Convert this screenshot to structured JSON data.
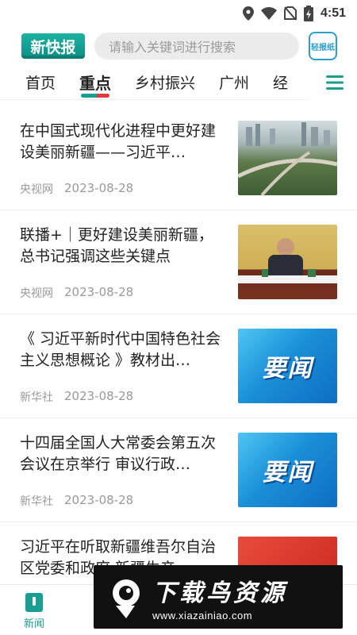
{
  "status_bar": {
    "time": "4:51",
    "icons": [
      "location-icon",
      "wifi-icon",
      "no-sim-icon",
      "battery-charging-icon"
    ]
  },
  "header": {
    "logo_text": "新快报",
    "search_placeholder": "请输入关键词进行搜索",
    "paper_button_label": "轻报纸"
  },
  "tabs": [
    {
      "label": "首页",
      "active": false
    },
    {
      "label": "重点",
      "active": true
    },
    {
      "label": "乡村振兴",
      "active": false
    },
    {
      "label": "广州",
      "active": false
    },
    {
      "label": "经",
      "active": false
    }
  ],
  "news": [
    {
      "title": "在中国式现代化进程中更好建设美丽新疆——习近平…",
      "source": "央视网",
      "date": "2023-08-28",
      "thumb": "city-aerial"
    },
    {
      "title": "联播+｜更好建设美丽新疆，总书记强调这些关键点",
      "source": "央视网",
      "date": "2023-08-28",
      "thumb": "meeting-photo"
    },
    {
      "title": "《 习近平新时代中国特色社会主义思想概论 》教材出…",
      "source": "新华社",
      "date": "2023-08-28",
      "thumb": "yaowen-banner"
    },
    {
      "title": "十四届全国人大常委会第五次会议在京举行 审议行政…",
      "source": "新华社",
      "date": "2023-08-28",
      "thumb": "yaowen-banner"
    },
    {
      "title": "习近平在听取新疆维吾尔自治区党委和政府 新疆生产…",
      "source": "",
      "date": "",
      "thumb": "red-banner"
    }
  ],
  "thumb_text": {
    "yaowen": "要闻"
  },
  "bottom_nav": {
    "news_label": "新闻"
  },
  "watermark": {
    "title": "下载鸟资源",
    "url": "www.xiazainiao.com"
  },
  "colors": {
    "brand": "#1b9e92",
    "accent_red": "#e23b3b",
    "link_blue": "#2a9fd6"
  }
}
